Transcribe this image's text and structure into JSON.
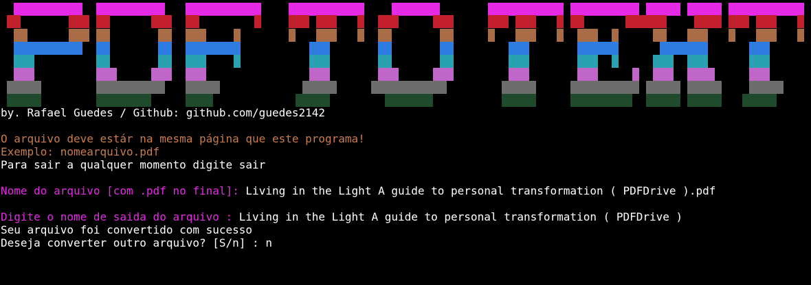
{
  "banner": {
    "text": "PDF TO TEXT",
    "palette": [
      "#e52ae5",
      "#c3202d",
      "#a86d47",
      "#2e7ce0",
      "#2aa1b0",
      "#c066c7",
      "#6d6d6d",
      "#1f4b2c"
    ]
  },
  "terminal": {
    "credits": "by. Rafael Guedes / Github: github.com/guedes2142",
    "warning": "O arquivo deve estár na mesma página que este programa!",
    "example": "Exemplo: nomearquivo.pdf",
    "exit_hint": "Para sair a qualquer momento digite sair",
    "input_prompt": "Nome do arquivo [com .pdf no final]: ",
    "input_value": "Living in the Light A guide to personal transformation ( PDFDrive ).pdf",
    "output_prompt": "Digite o nome de saida do arquivo : ",
    "output_value": "Living in the Light A guide to personal transformation ( PDFDrive )",
    "success": "Seu arquivo foi convertido com sucesso",
    "again_prompt": "Deseja converter outro arquivo? [S/n] : ",
    "again_value": "n"
  },
  "colors": {
    "background": "#000000",
    "text": "#ffffff",
    "info": "#c87c4f",
    "prompt": "#e52ae5"
  }
}
